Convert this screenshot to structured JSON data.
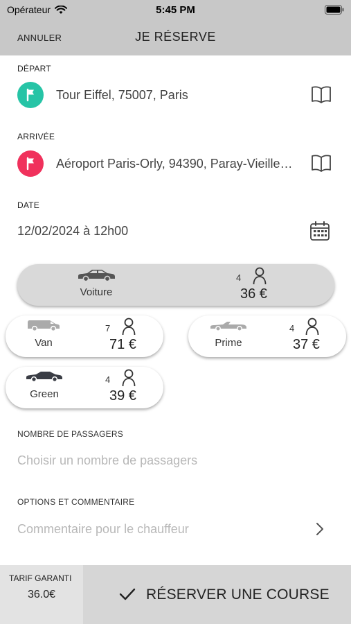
{
  "status_bar": {
    "carrier": "Opérateur",
    "time": "5:45 PM"
  },
  "navbar": {
    "cancel_label": "ANNULER",
    "title": "JE RÉSERVE"
  },
  "departure": {
    "label": "DÉPART",
    "address": "Tour Eiffel, 75007, Paris",
    "pin_color": "#26c4a6"
  },
  "arrival": {
    "label": "ARRIVÉE",
    "address": "Aéroport Paris-Orly, 94390, Paray-Vieille-Poste",
    "pin_color": "#f0315c"
  },
  "date": {
    "label": "DATE",
    "value": "12/02/2024 à 12h00"
  },
  "vehicles": [
    {
      "name": "Voiture",
      "seats": "4",
      "price": "36 €",
      "selected": true,
      "icon": "sedan-car-icon"
    },
    {
      "name": "Van",
      "seats": "7",
      "price": "71 €",
      "selected": false,
      "icon": "van-icon"
    },
    {
      "name": "Prime",
      "seats": "4",
      "price": "37 €",
      "selected": false,
      "icon": "convertible-car-icon"
    },
    {
      "name": "Green",
      "seats": "4",
      "price": "39 €",
      "selected": false,
      "icon": "green-car-icon"
    }
  ],
  "passengers": {
    "label": "NOMBRE DE PASSAGERS",
    "placeholder": "Choisir un nombre de passagers"
  },
  "options": {
    "label": "OPTIONS ET COMMENTAIRE",
    "placeholder": "Commentaire pour le chauffeur"
  },
  "bottom": {
    "tarif_label": "TARIF GARANTI",
    "tarif_value": "36.0€",
    "reserve_label": "RÉSERVER UNE COURSE"
  }
}
